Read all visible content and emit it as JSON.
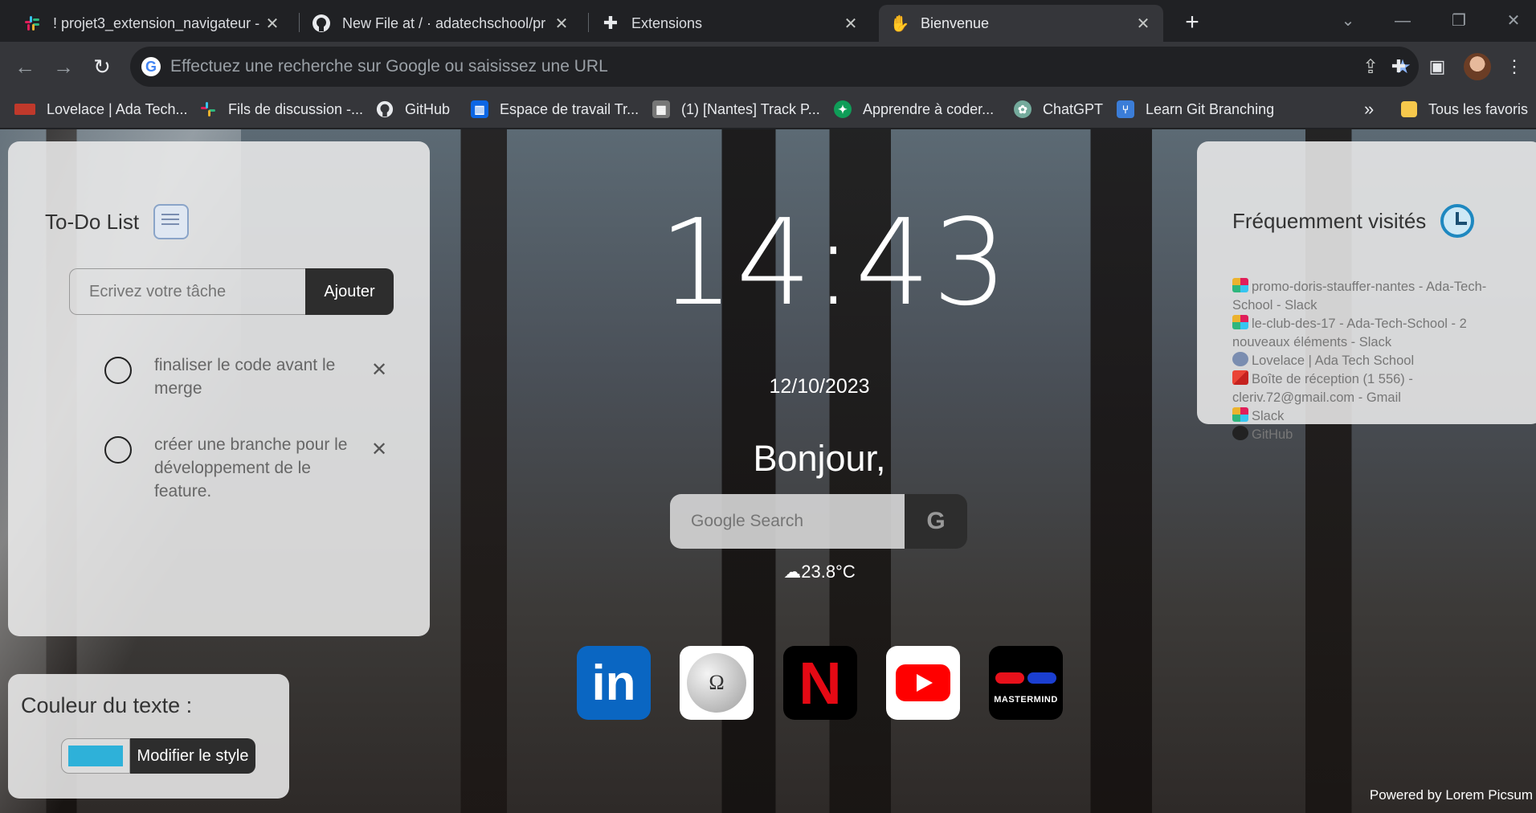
{
  "tabs": [
    {
      "title": "! projet3_extension_navigateur -",
      "icon": "slack-icon"
    },
    {
      "title": "New File at / · adatechschool/pr",
      "icon": "github-icon"
    },
    {
      "title": "Extensions",
      "icon": "puzzle-icon"
    },
    {
      "title": "Bienvenue",
      "icon": "wave-hand-icon"
    }
  ],
  "omnibox": {
    "placeholder": "Effectuez une recherche sur Google ou saisissez une URL"
  },
  "bookmarks": [
    {
      "label": "Lovelace | Ada Tech...",
      "icon": "lovelace-icon"
    },
    {
      "label": "Fils de discussion -...",
      "icon": "slack-icon"
    },
    {
      "label": "GitHub",
      "icon": "github-icon"
    },
    {
      "label": "Espace de travail Tr...",
      "icon": "trello-icon"
    },
    {
      "label": "(1) [Nantes] Track P...",
      "icon": "track-icon"
    },
    {
      "label": "Apprendre à coder...",
      "icon": "code-icon"
    },
    {
      "label": "ChatGPT",
      "icon": "chatgpt-icon"
    },
    {
      "label": "Learn Git Branching",
      "icon": "git-branch-icon"
    }
  ],
  "bookmarks_more": "»",
  "all_bookmarks": "Tous les favoris",
  "todo": {
    "title": "To-Do List",
    "input_placeholder": "Ecrivez votre tâche",
    "add_label": "Ajouter",
    "tasks": [
      {
        "text": "finaliser le code avant le merge",
        "done": false
      },
      {
        "text": "créer une branche pour le développement de le feature.",
        "done": false
      }
    ]
  },
  "style_panel": {
    "title": "Couleur du texte :",
    "color": "#2eb1d9",
    "button_label": "Modifier le style"
  },
  "clock": {
    "time": "14:43",
    "date": "12/10/2023"
  },
  "greeting": "Bonjour,",
  "search": {
    "placeholder": "Google Search",
    "button": "G"
  },
  "weather": {
    "icon": "cloud-icon",
    "temp": "23.8°C"
  },
  "apps": [
    {
      "name": "linkedin",
      "glyph": "in"
    },
    {
      "name": "wikipedia",
      "glyph": "Ω"
    },
    {
      "name": "netflix",
      "glyph": "N"
    },
    {
      "name": "youtube",
      "glyph": ""
    },
    {
      "name": "mastermind",
      "glyph": "MASTERMIND"
    }
  ],
  "frequent": {
    "title": "Fréquemment visités",
    "items": [
      {
        "icon": "slack-icon",
        "text": "promo-doris-stauffer-nantes - Ada-Tech-School - Slack"
      },
      {
        "icon": "slack-icon",
        "text": "le-club-des-17 - Ada-Tech-School - 2 nouveaux éléments - Slack"
      },
      {
        "icon": "globe-icon",
        "text": "Lovelace | Ada Tech School"
      },
      {
        "icon": "gmail-icon",
        "text": "Boîte de réception (1 556) - cleriv.72@gmail.com - Gmail"
      },
      {
        "icon": "slack-icon",
        "text": "Slack"
      },
      {
        "icon": "github-icon",
        "text": "GitHub"
      }
    ]
  },
  "powered_by": "Powered by Lorem Picsum"
}
